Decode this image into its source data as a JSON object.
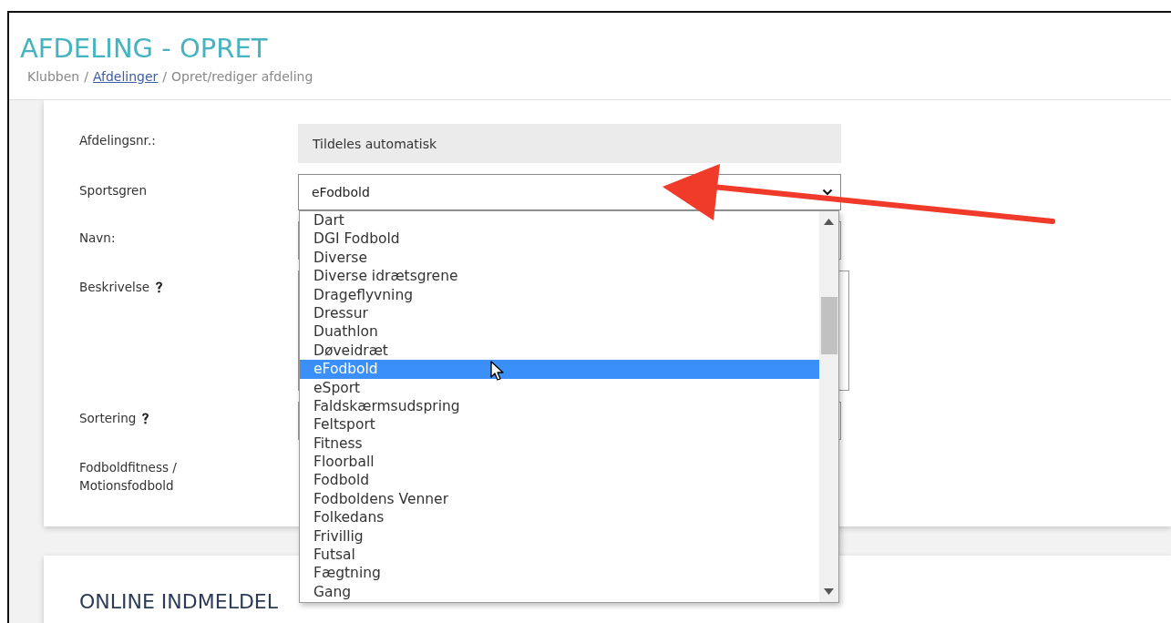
{
  "header": {
    "title": "AFDELING - OPRET",
    "breadcrumb": [
      {
        "kind": "text",
        "label": "Klubben"
      },
      {
        "kind": "separator",
        "label": "/"
      },
      {
        "kind": "link",
        "label": "Afdelinger"
      },
      {
        "kind": "separator",
        "label": "/"
      },
      {
        "kind": "text",
        "label": "Opret/rediger afdeling"
      }
    ]
  },
  "form": {
    "fields": [
      {
        "kind": "static",
        "label": "Afdelingsnr.:",
        "help": false,
        "value": "Tildeles automatisk"
      },
      {
        "kind": "select",
        "label": "Sportsgren",
        "help": false,
        "value": "eFodbold",
        "expanded": true
      },
      {
        "kind": "text",
        "label": "Navn:",
        "help": false
      },
      {
        "kind": "textarea",
        "label": "Beskrivelse",
        "help": true
      },
      {
        "kind": "text",
        "label": "Sortering",
        "help": true
      },
      {
        "kind": "plain",
        "label": "Fodboldfitness / Motionsfodbold",
        "help": false
      }
    ]
  },
  "dropdown": {
    "options": [
      {
        "label": "Dart",
        "selected": false
      },
      {
        "label": "DGI Fodbold",
        "selected": false
      },
      {
        "label": "Diverse",
        "selected": false
      },
      {
        "label": "Diverse idrætsgrene",
        "selected": false
      },
      {
        "label": "Drageflyvning",
        "selected": false
      },
      {
        "label": "Dressur",
        "selected": false
      },
      {
        "label": "Duathlon",
        "selected": false
      },
      {
        "label": "Døveidræt",
        "selected": false
      },
      {
        "label": "eFodbold",
        "selected": true
      },
      {
        "label": "eSport",
        "selected": false
      },
      {
        "label": "Faldskærmsudspring",
        "selected": false
      },
      {
        "label": "Feltsport",
        "selected": false
      },
      {
        "label": "Fitness",
        "selected": false
      },
      {
        "label": "Floorball",
        "selected": false
      },
      {
        "label": "Fodbold",
        "selected": false
      },
      {
        "label": "Fodboldens Venner",
        "selected": false
      },
      {
        "label": "Folkedans",
        "selected": false
      },
      {
        "label": "Frivillig",
        "selected": false
      },
      {
        "label": "Futsal",
        "selected": false
      },
      {
        "label": "Fægtning",
        "selected": false
      },
      {
        "label": "Gang",
        "selected": false
      }
    ]
  },
  "section2": {
    "title": "ONLINE INDMELDEL"
  }
}
